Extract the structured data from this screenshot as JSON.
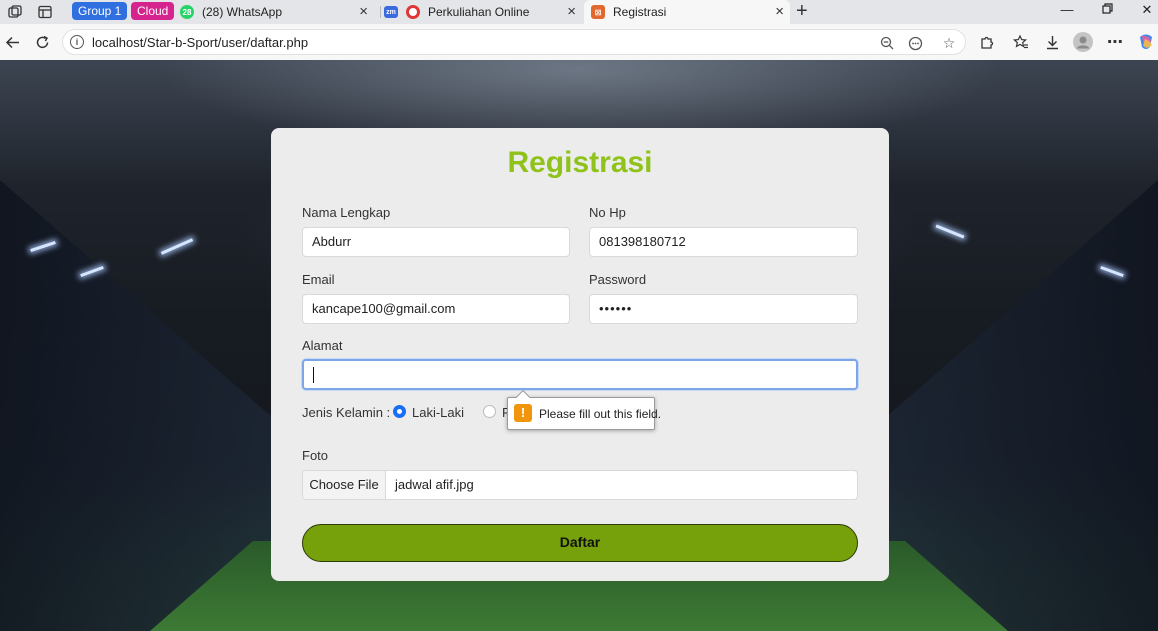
{
  "browser": {
    "tab_groups": [
      {
        "label": "Group 1",
        "color": "#2f6fe0"
      },
      {
        "label": "Cloud",
        "color": "#d6248f"
      }
    ],
    "tabs": [
      {
        "title": "(28) WhatsApp",
        "icon": "whatsapp-icon"
      },
      {
        "title": "Perkuliahan Online",
        "icon": "record-icon"
      },
      {
        "title": "Registrasi",
        "icon": "site-icon",
        "active": true
      }
    ],
    "url": "localhost/Star-b-Sport/user/daftar.php"
  },
  "form": {
    "title": "Registrasi",
    "accent_color": "#8fc21a",
    "button_color": "#76a10b",
    "nama_label": "Nama Lengkap",
    "nama_value": "Abdurr",
    "hp_label": "No Hp",
    "hp_value": "081398180712",
    "email_label": "Email",
    "email_value": "kancape100@gmail.com",
    "password_label": "Password",
    "password_value": "••••••",
    "alamat_label": "Alamat",
    "alamat_value": "",
    "gender_label": "Jenis Kelamin :",
    "gender_options": [
      {
        "label": "Laki-Laki",
        "selected": true
      },
      {
        "label": "P",
        "selected": false
      }
    ],
    "foto_label": "Foto",
    "choose_file_label": "Choose File",
    "file_name": "jadwal afif.jpg",
    "submit_label": "Daftar",
    "validation_message": "Please fill out this field."
  }
}
